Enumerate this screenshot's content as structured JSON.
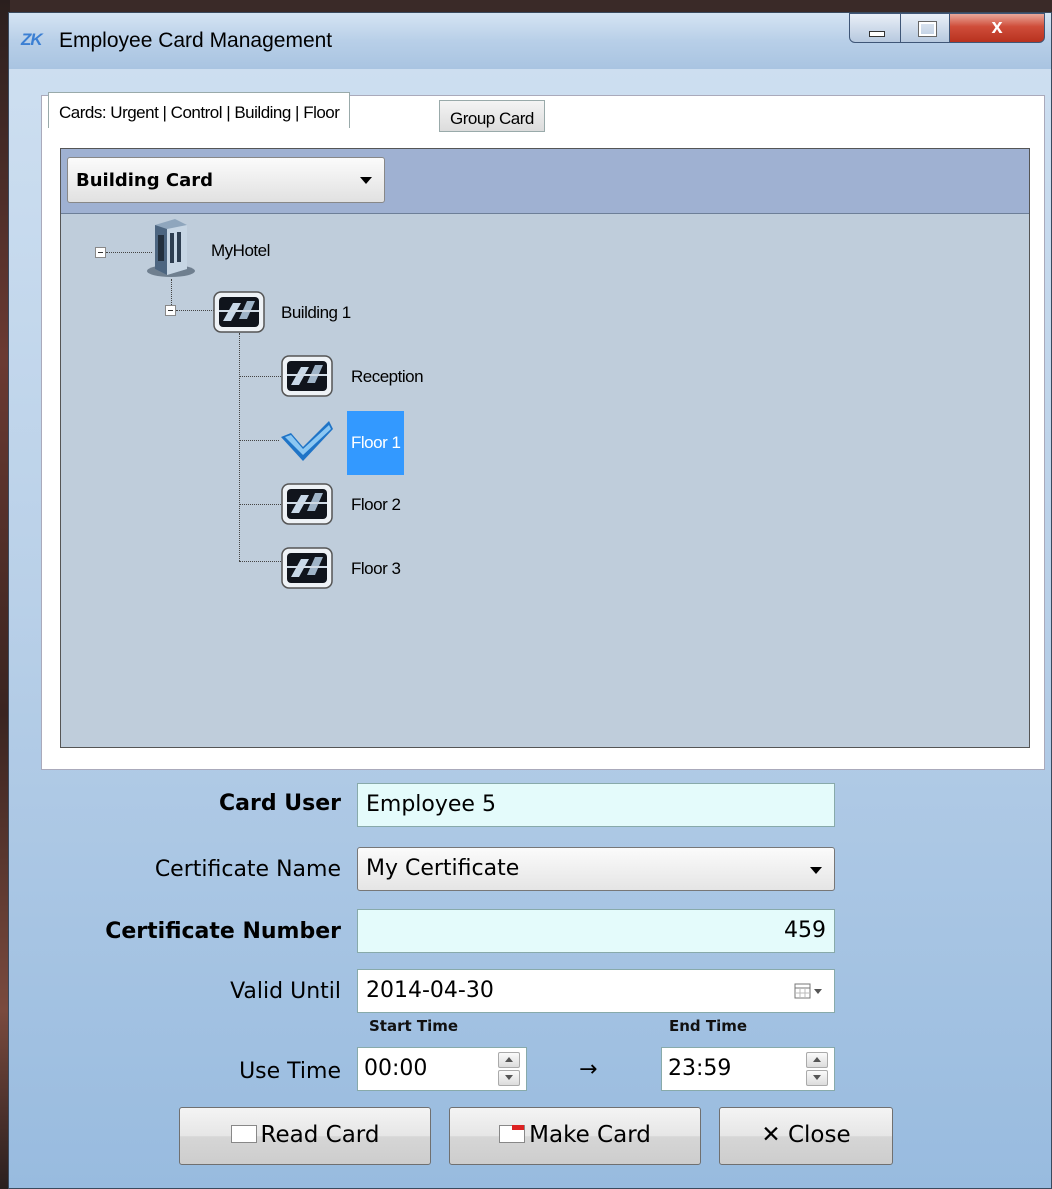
{
  "window": {
    "app_icon": "ZK",
    "title": "Employee Card Management",
    "close_glyph": "x"
  },
  "tabs": [
    {
      "label": "Cards: Urgent | Control | Building | Floor",
      "active": true
    },
    {
      "label": "Group Card",
      "active": false
    }
  ],
  "card_type": {
    "selected": "Building Card"
  },
  "tree": {
    "root": {
      "label": "MyHotel",
      "icon": "hotel-building-icon",
      "expanded": true
    },
    "building": {
      "label": "Building 1",
      "icon": "building-icon",
      "expanded": true
    },
    "children": [
      {
        "label": "Reception",
        "icon": "building-icon",
        "checked": false
      },
      {
        "label": "Floor 1",
        "icon": "checkmark-icon",
        "checked": true,
        "selected": true
      },
      {
        "label": "Floor 2",
        "icon": "building-icon",
        "checked": false
      },
      {
        "label": "Floor 3",
        "icon": "building-icon",
        "checked": false
      }
    ]
  },
  "form": {
    "card_user_label": "Card User",
    "card_user_value": "Employee 5",
    "certificate_name_label": "Certificate Name",
    "certificate_name_value": "My Certificate",
    "certificate_number_label": "Certificate Number",
    "certificate_number_value": "459",
    "valid_until_label": "Valid Until",
    "valid_until_value": "2014-04-30",
    "start_time_label": "Start Time",
    "end_time_label": "End Time",
    "use_time_label": "Use Time",
    "start_time_value": "00:00",
    "end_time_value": "23:59",
    "arrow": "→"
  },
  "buttons": {
    "read_card": "Read Card",
    "make_card": "Make Card",
    "close": "✕ Close"
  },
  "colors": {
    "selection": "#3399ff",
    "highlight_input": "#e4fbfb",
    "panel_header": "#9fb1d2",
    "tree_background": "#bfcddb"
  }
}
